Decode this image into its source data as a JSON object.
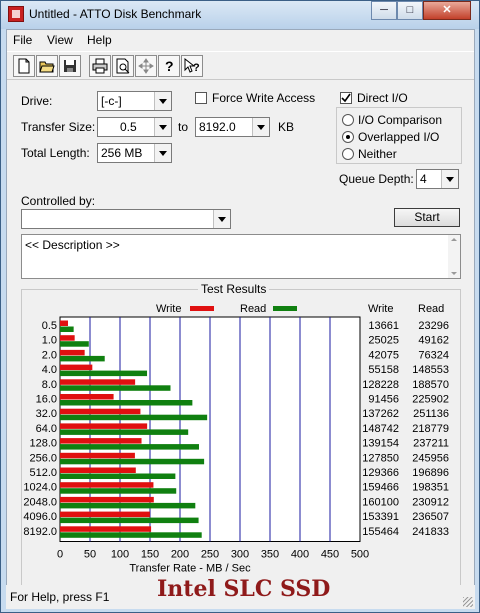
{
  "window": {
    "title": "Untitled - ATTO Disk Benchmark",
    "minimize": "─",
    "maximize": "□",
    "close": "✕"
  },
  "menu": [
    "File",
    "View",
    "Help"
  ],
  "toolbar": [
    "new-icon",
    "open-icon",
    "save-icon",
    "print-icon",
    "print-preview-icon",
    "move-icon",
    "help-icon",
    "context-help-icon"
  ],
  "drive": {
    "label": "Drive:",
    "value": "[-c-]"
  },
  "transfer_size": {
    "label": "Transfer Size:",
    "from": "0.5",
    "to_label": "to",
    "to": "8192.0",
    "unit": "KB"
  },
  "total_length": {
    "label": "Total Length:",
    "value": "256 MB"
  },
  "force_write": {
    "label": "Force Write Access",
    "checked": false
  },
  "direct_io": {
    "label": "Direct I/O",
    "checked": true
  },
  "mode": {
    "options": [
      "I/O Comparison",
      "Overlapped I/O",
      "Neither"
    ],
    "selected": "Overlapped I/O"
  },
  "queue_depth": {
    "label": "Queue Depth:",
    "value": "4"
  },
  "controlled_by": {
    "label": "Controlled by:",
    "value": ""
  },
  "start_button": "Start",
  "description": "<< Description >>",
  "results": {
    "title": "Test Results",
    "legend_write": "Write",
    "legend_read": "Read",
    "col_write": "Write",
    "col_read": "Read",
    "write_color": "#e01010",
    "read_color": "#108010",
    "grid_color": "#1a1aa0"
  },
  "chart_data": {
    "type": "bar",
    "orientation": "horizontal",
    "title": "Test Results",
    "xlabel": "Transfer Rate - MB / Sec",
    "ylabel": "",
    "xlim": [
      0,
      500
    ],
    "xticks": [
      "0",
      "50",
      "100",
      "150",
      "200",
      "250",
      "300",
      "350",
      "400",
      "450",
      "500"
    ],
    "categories": [
      "0.5",
      "1.0",
      "2.0",
      "4.0",
      "8.0",
      "16.0",
      "32.0",
      "64.0",
      "128.0",
      "256.0",
      "512.0",
      "1024.0",
      "2048.0",
      "4096.0",
      "8192.0"
    ],
    "series": [
      {
        "name": "Write",
        "values_kb": [
          "13661",
          "25025",
          "42075",
          "55158",
          "128228",
          "91456",
          "137262",
          "148742",
          "139154",
          "127850",
          "129366",
          "159466",
          "160100",
          "153391",
          "155464"
        ]
      },
      {
        "name": "Read",
        "values_kb": [
          "23296",
          "49162",
          "76324",
          "148553",
          "188570",
          "225902",
          "251136",
          "218779",
          "237211",
          "245956",
          "196896",
          "198351",
          "230912",
          "236507",
          "241833"
        ]
      }
    ],
    "grid": true,
    "legend": "top"
  },
  "status_text": "For Help, press F1",
  "banner": "Intel SLC SSD"
}
